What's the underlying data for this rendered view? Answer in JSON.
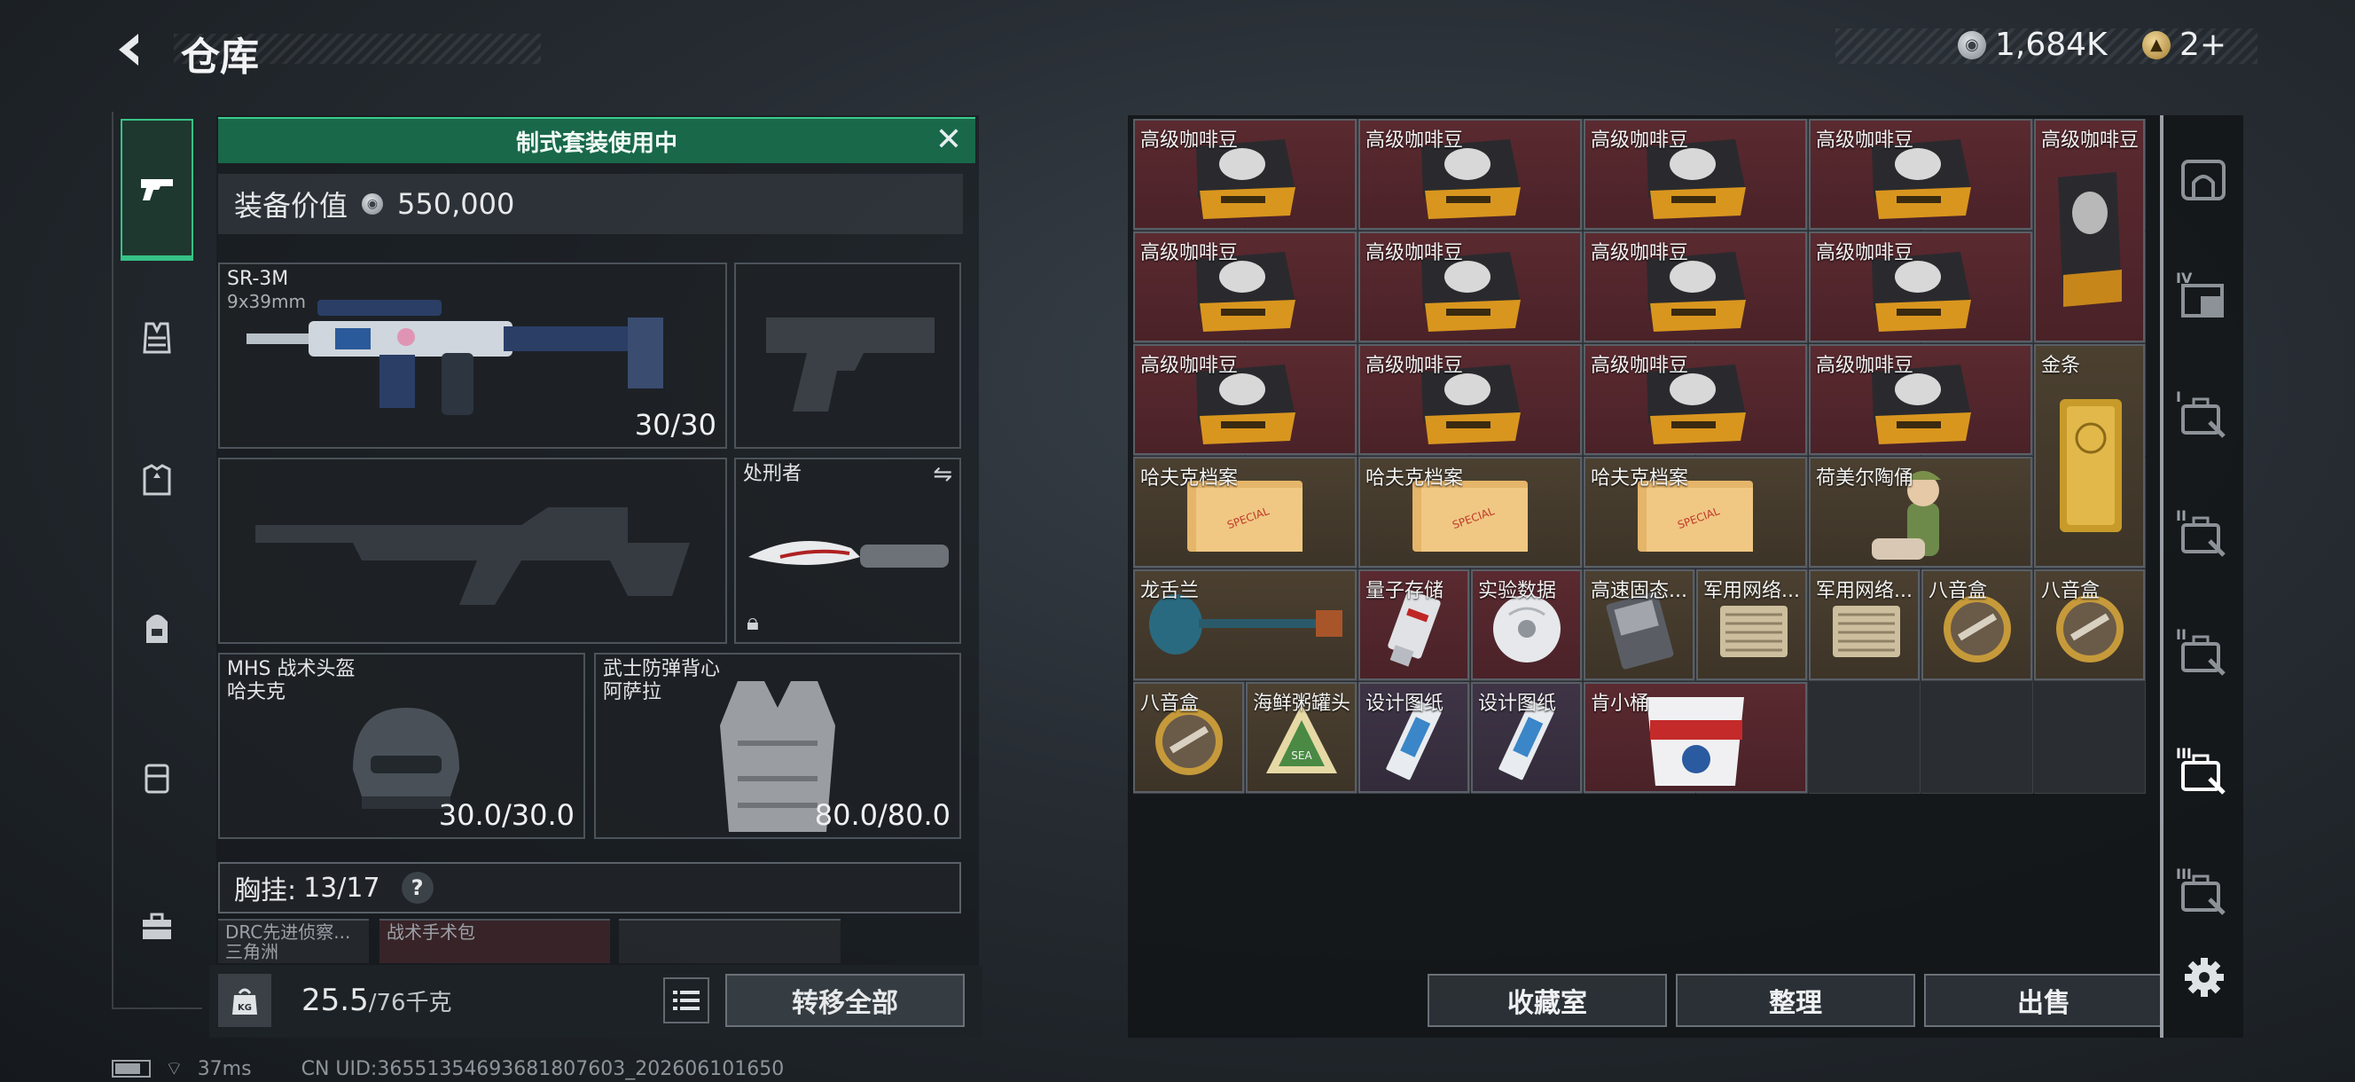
{
  "header": {
    "title": "仓库",
    "currency_silver": "1,684K",
    "currency_gold": "2+"
  },
  "left_tabs": [
    "firearms-icon",
    "vest-icon",
    "armor-icon",
    "backpack-icon",
    "rig-icon",
    "toolbox-icon"
  ],
  "loadout": {
    "kit_banner": "制式套装使用中",
    "equip_value_label": "装备价值",
    "equip_value": "550,000",
    "primary_weapon": {
      "name": "SR-3M",
      "ammo": "9x39mm",
      "durability": "30/30"
    },
    "melee": {
      "name": "处刑者"
    },
    "helmet": {
      "name": "MHS 战术头盔",
      "sub": "哈夫克",
      "durability": "30.0/30.0"
    },
    "armor": {
      "name": "武士防弹背心",
      "sub": "阿萨拉",
      "durability": "80.0/80.0"
    },
    "chest_rig": {
      "label": "胸挂:",
      "capacity": "13/17",
      "help": "?"
    },
    "pouches": [
      "DRC先进侦察...",
      "三角洲",
      "战术手术包"
    ],
    "weight_icon": "KG",
    "weight_current": "25.5",
    "weight_max": "/76千克",
    "transfer_all": "转移全部"
  },
  "storage": {
    "items": [
      {
        "name": "高级咖啡豆",
        "rarity": "red",
        "art": "coffee"
      },
      {
        "name": "高级咖啡豆",
        "rarity": "red",
        "art": "coffee"
      },
      {
        "name": "高级咖啡豆",
        "rarity": "red",
        "art": "coffee"
      },
      {
        "name": "高级咖啡豆",
        "rarity": "red",
        "art": "coffee"
      },
      {
        "name": "高级咖啡豆",
        "rarity": "red",
        "art": "coffee-tall"
      },
      {
        "name": "高级咖啡豆",
        "rarity": "red",
        "art": "coffee"
      },
      {
        "name": "高级咖啡豆",
        "rarity": "red",
        "art": "coffee"
      },
      {
        "name": "高级咖啡豆",
        "rarity": "red",
        "art": "coffee"
      },
      {
        "name": "高级咖啡豆",
        "rarity": "red",
        "art": "coffee"
      },
      {
        "name": "高级咖啡豆",
        "rarity": "red",
        "art": "coffee"
      },
      {
        "name": "高级咖啡豆",
        "rarity": "red",
        "art": "coffee"
      },
      {
        "name": "高级咖啡豆",
        "rarity": "red",
        "art": "coffee"
      },
      {
        "name": "高级咖啡豆",
        "rarity": "red",
        "art": "coffee"
      },
      {
        "name": "金条",
        "rarity": "gold",
        "art": "goldbar"
      },
      {
        "name": "哈夫克档案",
        "rarity": "gold",
        "art": "file"
      },
      {
        "name": "哈夫克档案",
        "rarity": "gold",
        "art": "file"
      },
      {
        "name": "哈夫克档案",
        "rarity": "gold",
        "art": "file"
      },
      {
        "name": "荷美尔陶俑",
        "rarity": "gold",
        "art": "figurine"
      },
      {
        "name": "龙舌兰",
        "rarity": "gold",
        "art": "bottle"
      },
      {
        "name": "量子存储",
        "rarity": "red",
        "art": "usb"
      },
      {
        "name": "实验数据",
        "rarity": "red",
        "art": "disc"
      },
      {
        "name": "高速固态...",
        "rarity": "gold",
        "art": "ssd"
      },
      {
        "name": "军用网络...",
        "rarity": "gold",
        "art": "router"
      },
      {
        "name": "军用网络...",
        "rarity": "gold",
        "art": "router"
      },
      {
        "name": "八音盒",
        "rarity": "gold",
        "art": "musicbox"
      },
      {
        "name": "八音盒",
        "rarity": "gold",
        "art": "musicbox"
      },
      {
        "name": "八音盒",
        "rarity": "gold",
        "art": "musicbox"
      },
      {
        "name": "海鲜粥罐头",
        "rarity": "gold",
        "art": "can"
      },
      {
        "name": "设计图纸",
        "rarity": "purple",
        "art": "blueprint"
      },
      {
        "name": "设计图纸",
        "rarity": "purple",
        "art": "blueprint"
      },
      {
        "name": "肯小桶",
        "rarity": "red",
        "art": "bucket"
      }
    ],
    "collection_room": "收藏室",
    "sort": "整理",
    "sell": "出售"
  },
  "right_rail": {
    "tabs": [
      {
        "tier": "",
        "icon": "vault-icon"
      },
      {
        "tier": "IV",
        "icon": "folder-icon"
      },
      {
        "tier": "I",
        "icon": "case-icon"
      },
      {
        "tier": "II",
        "icon": "case-icon"
      },
      {
        "tier": "II",
        "icon": "case-icon"
      },
      {
        "tier": "III",
        "icon": "case-icon"
      },
      {
        "tier": "III",
        "icon": "case-lock-icon"
      }
    ]
  },
  "footer": {
    "ping": "37ms",
    "uid": "CN UID:3655135469368180760​3_202606101650"
  },
  "colors": {
    "accent_green": "#19684a",
    "rarity_red": "#5a2a30",
    "rarity_gold": "#4b4030",
    "rarity_purple": "#3e3446"
  }
}
